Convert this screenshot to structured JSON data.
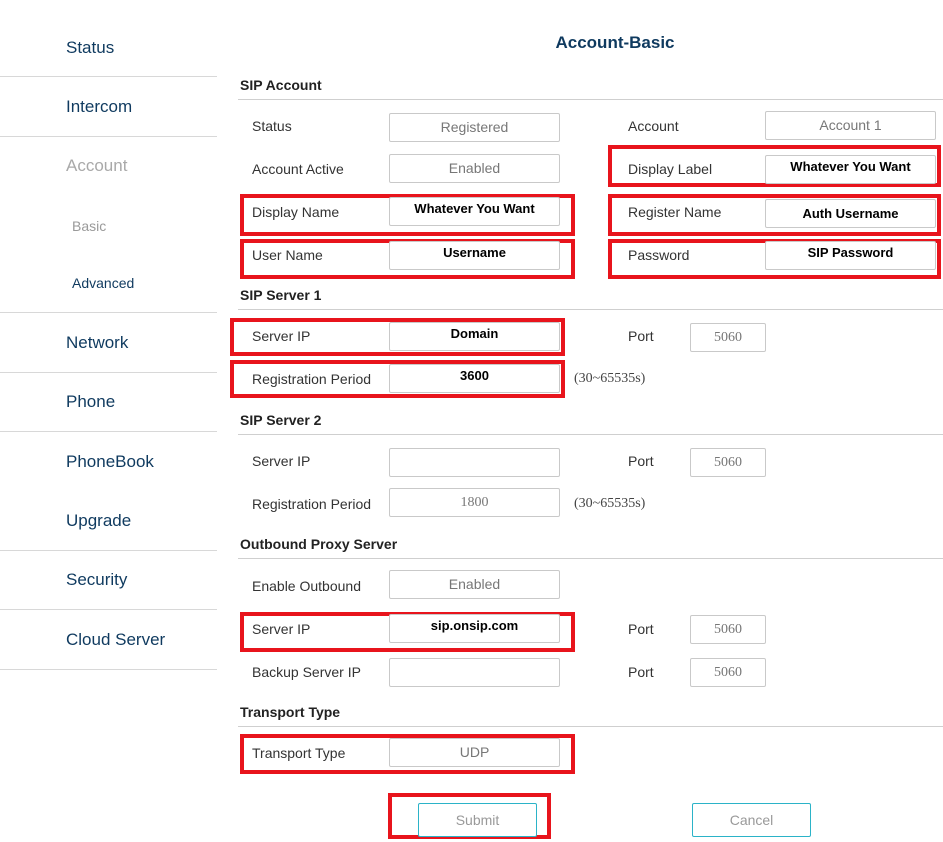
{
  "sidebar": {
    "items": [
      {
        "label": "Status"
      },
      {
        "label": "Intercom"
      },
      {
        "label": "Account"
      },
      {
        "label": "Basic"
      },
      {
        "label": "Advanced"
      },
      {
        "label": "Network"
      },
      {
        "label": "Phone"
      },
      {
        "label": "PhoneBook"
      },
      {
        "label": "Upgrade"
      },
      {
        "label": "Security"
      },
      {
        "label": "Cloud Server"
      }
    ]
  },
  "page": {
    "title": "Account-Basic"
  },
  "sip_account": {
    "title": "SIP Account",
    "status_label": "Status",
    "status_value": "Registered",
    "account_label": "Account",
    "account_value": "Account 1",
    "active_label": "Account Active",
    "active_value": "Enabled",
    "display_label_label": "Display Label",
    "display_label_value": "Whatever You Want",
    "display_name_label": "Display Name",
    "display_name_value": "Whatever You Want",
    "register_name_label": "Register Name",
    "register_name_value": "Auth Username",
    "user_name_label": "User Name",
    "user_name_value": "Username",
    "password_label": "Password",
    "password_value": "SIP Password"
  },
  "sip_server_1": {
    "title": "SIP Server 1",
    "server_ip_label": "Server IP",
    "server_ip_value": "Domain",
    "port_label": "Port",
    "port_value": "5060",
    "reg_period_label": "Registration Period",
    "reg_period_value": "3600",
    "reg_hint": "(30~65535s)"
  },
  "sip_server_2": {
    "title": "SIP Server 2",
    "server_ip_label": "Server IP",
    "server_ip_value": "",
    "port_label": "Port",
    "port_value": "5060",
    "reg_period_label": "Registration Period",
    "reg_period_value": "1800",
    "reg_hint": "(30~65535s)"
  },
  "outbound": {
    "title": "Outbound Proxy Server",
    "enable_label": "Enable Outbound",
    "enable_value": "Enabled",
    "server_ip_label": "Server IP",
    "server_ip_value": "sip.onsip.com",
    "port_label": "Port",
    "port_value": "5060",
    "backup_label": "Backup Server IP",
    "backup_value": "",
    "backup_port_label": "Port",
    "backup_port_value": "5060"
  },
  "transport": {
    "title": "Transport Type",
    "label": "Transport Type",
    "value": "UDP"
  },
  "actions": {
    "submit": "Submit",
    "cancel": "Cancel"
  },
  "colors": {
    "highlight": "#e8141c",
    "nav_text": "#0f3a5f",
    "button_border": "#2bb3c8"
  }
}
